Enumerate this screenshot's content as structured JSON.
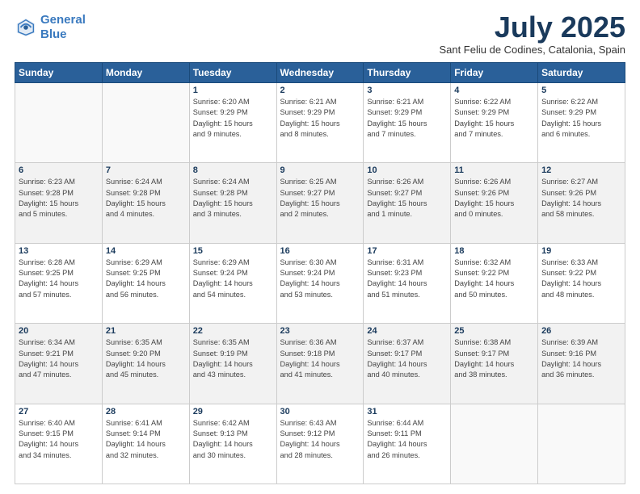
{
  "header": {
    "logo_line1": "General",
    "logo_line2": "Blue",
    "month": "July 2025",
    "location": "Sant Feliu de Codines, Catalonia, Spain"
  },
  "days_of_week": [
    "Sunday",
    "Monday",
    "Tuesday",
    "Wednesday",
    "Thursday",
    "Friday",
    "Saturday"
  ],
  "weeks": [
    [
      {
        "day": "",
        "info": ""
      },
      {
        "day": "",
        "info": ""
      },
      {
        "day": "1",
        "info": "Sunrise: 6:20 AM\nSunset: 9:29 PM\nDaylight: 15 hours\nand 9 minutes."
      },
      {
        "day": "2",
        "info": "Sunrise: 6:21 AM\nSunset: 9:29 PM\nDaylight: 15 hours\nand 8 minutes."
      },
      {
        "day": "3",
        "info": "Sunrise: 6:21 AM\nSunset: 9:29 PM\nDaylight: 15 hours\nand 7 minutes."
      },
      {
        "day": "4",
        "info": "Sunrise: 6:22 AM\nSunset: 9:29 PM\nDaylight: 15 hours\nand 7 minutes."
      },
      {
        "day": "5",
        "info": "Sunrise: 6:22 AM\nSunset: 9:29 PM\nDaylight: 15 hours\nand 6 minutes."
      }
    ],
    [
      {
        "day": "6",
        "info": "Sunrise: 6:23 AM\nSunset: 9:28 PM\nDaylight: 15 hours\nand 5 minutes."
      },
      {
        "day": "7",
        "info": "Sunrise: 6:24 AM\nSunset: 9:28 PM\nDaylight: 15 hours\nand 4 minutes."
      },
      {
        "day": "8",
        "info": "Sunrise: 6:24 AM\nSunset: 9:28 PM\nDaylight: 15 hours\nand 3 minutes."
      },
      {
        "day": "9",
        "info": "Sunrise: 6:25 AM\nSunset: 9:27 PM\nDaylight: 15 hours\nand 2 minutes."
      },
      {
        "day": "10",
        "info": "Sunrise: 6:26 AM\nSunset: 9:27 PM\nDaylight: 15 hours\nand 1 minute."
      },
      {
        "day": "11",
        "info": "Sunrise: 6:26 AM\nSunset: 9:26 PM\nDaylight: 15 hours\nand 0 minutes."
      },
      {
        "day": "12",
        "info": "Sunrise: 6:27 AM\nSunset: 9:26 PM\nDaylight: 14 hours\nand 58 minutes."
      }
    ],
    [
      {
        "day": "13",
        "info": "Sunrise: 6:28 AM\nSunset: 9:25 PM\nDaylight: 14 hours\nand 57 minutes."
      },
      {
        "day": "14",
        "info": "Sunrise: 6:29 AM\nSunset: 9:25 PM\nDaylight: 14 hours\nand 56 minutes."
      },
      {
        "day": "15",
        "info": "Sunrise: 6:29 AM\nSunset: 9:24 PM\nDaylight: 14 hours\nand 54 minutes."
      },
      {
        "day": "16",
        "info": "Sunrise: 6:30 AM\nSunset: 9:24 PM\nDaylight: 14 hours\nand 53 minutes."
      },
      {
        "day": "17",
        "info": "Sunrise: 6:31 AM\nSunset: 9:23 PM\nDaylight: 14 hours\nand 51 minutes."
      },
      {
        "day": "18",
        "info": "Sunrise: 6:32 AM\nSunset: 9:22 PM\nDaylight: 14 hours\nand 50 minutes."
      },
      {
        "day": "19",
        "info": "Sunrise: 6:33 AM\nSunset: 9:22 PM\nDaylight: 14 hours\nand 48 minutes."
      }
    ],
    [
      {
        "day": "20",
        "info": "Sunrise: 6:34 AM\nSunset: 9:21 PM\nDaylight: 14 hours\nand 47 minutes."
      },
      {
        "day": "21",
        "info": "Sunrise: 6:35 AM\nSunset: 9:20 PM\nDaylight: 14 hours\nand 45 minutes."
      },
      {
        "day": "22",
        "info": "Sunrise: 6:35 AM\nSunset: 9:19 PM\nDaylight: 14 hours\nand 43 minutes."
      },
      {
        "day": "23",
        "info": "Sunrise: 6:36 AM\nSunset: 9:18 PM\nDaylight: 14 hours\nand 41 minutes."
      },
      {
        "day": "24",
        "info": "Sunrise: 6:37 AM\nSunset: 9:17 PM\nDaylight: 14 hours\nand 40 minutes."
      },
      {
        "day": "25",
        "info": "Sunrise: 6:38 AM\nSunset: 9:17 PM\nDaylight: 14 hours\nand 38 minutes."
      },
      {
        "day": "26",
        "info": "Sunrise: 6:39 AM\nSunset: 9:16 PM\nDaylight: 14 hours\nand 36 minutes."
      }
    ],
    [
      {
        "day": "27",
        "info": "Sunrise: 6:40 AM\nSunset: 9:15 PM\nDaylight: 14 hours\nand 34 minutes."
      },
      {
        "day": "28",
        "info": "Sunrise: 6:41 AM\nSunset: 9:14 PM\nDaylight: 14 hours\nand 32 minutes."
      },
      {
        "day": "29",
        "info": "Sunrise: 6:42 AM\nSunset: 9:13 PM\nDaylight: 14 hours\nand 30 minutes."
      },
      {
        "day": "30",
        "info": "Sunrise: 6:43 AM\nSunset: 9:12 PM\nDaylight: 14 hours\nand 28 minutes."
      },
      {
        "day": "31",
        "info": "Sunrise: 6:44 AM\nSunset: 9:11 PM\nDaylight: 14 hours\nand 26 minutes."
      },
      {
        "day": "",
        "info": ""
      },
      {
        "day": "",
        "info": ""
      }
    ]
  ]
}
